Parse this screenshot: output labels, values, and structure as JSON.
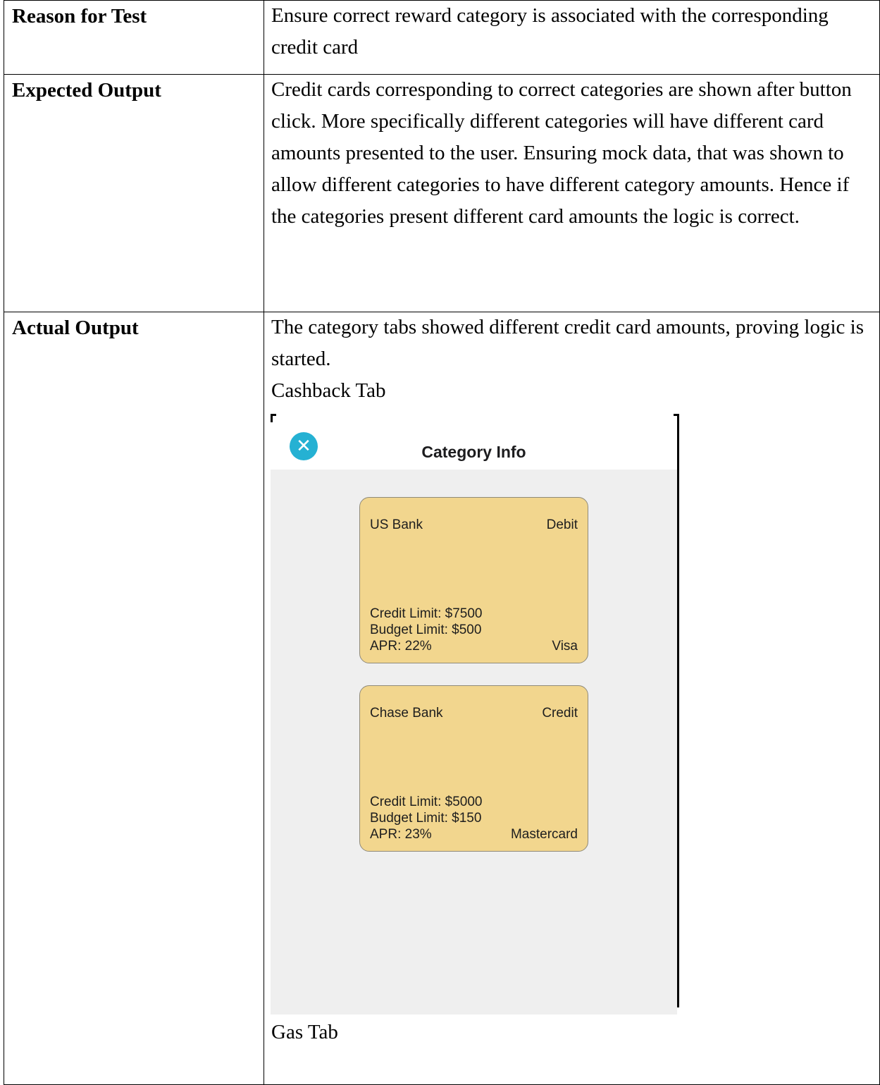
{
  "rows": {
    "reason": {
      "label": "Reason for Test",
      "text": "Ensure correct reward category is associated with the corresponding credit card"
    },
    "expected": {
      "label": "Expected Output",
      "text": "Credit cards corresponding to correct categories are shown after button click. More specifically different categories will have different card amounts presented to the user. Ensuring mock data, that was shown to allow different categories to have different category amounts. Hence if the categories present different card amounts the logic is correct."
    },
    "actual": {
      "label": "Actual Output",
      "text": "The category tabs showed different credit card amounts, proving logic is started.",
      "caption_1": "Cashback Tab",
      "caption_2": "Gas Tab"
    }
  },
  "screenshot": {
    "title": "Category Info",
    "close_icon": "close-icon",
    "accent_color": "#25b1d3",
    "card_color": "#f2d68e",
    "cards": [
      {
        "bank": "US Bank",
        "type": "Debit",
        "credit_limit": "Credit Limit: $7500",
        "budget_limit": "Budget Limit: $500",
        "apr": "APR: 22%",
        "network": "Visa"
      },
      {
        "bank": "Chase Bank",
        "type": "Credit",
        "credit_limit": "Credit Limit: $5000",
        "budget_limit": "Budget Limit: $150",
        "apr": "APR: 23%",
        "network": "Mastercard"
      }
    ]
  }
}
